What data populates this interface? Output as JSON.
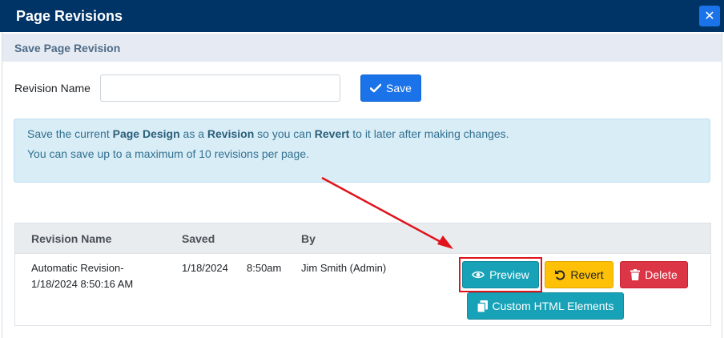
{
  "dialog": {
    "title": "Page Revisions",
    "close_icon": "close-icon"
  },
  "save_section": {
    "header": "Save Page Revision",
    "revision_name_label": "Revision Name",
    "revision_name_value": "",
    "save_label": "Save"
  },
  "info": {
    "line1": {
      "pre": "Save the current ",
      "bold1": "Page Design",
      "mid1": " as a ",
      "bold2": "Revision",
      "mid2": " so you can ",
      "bold3": "Revert",
      "post": " to it later after making changes."
    },
    "line2": "You can save up to a maximum of 10 revisions per page."
  },
  "table": {
    "headers": [
      "Revision Name",
      "Saved",
      "By"
    ],
    "rows": [
      {
        "name_line1": "Automatic Revision-",
        "name_line2": "1/18/2024 8:50:16 AM",
        "saved_date": "1/18/2024",
        "saved_time": "8:50am",
        "by": "Jim Smith (Admin)",
        "actions": {
          "preview": "Preview",
          "revert": "Revert",
          "delete": "Delete",
          "custom_html": "Custom HTML Elements"
        }
      }
    ]
  },
  "colors": {
    "titlebar": "#003366",
    "primary": "#1a73e8",
    "info": "#17a2b8",
    "warning": "#ffc107",
    "danger": "#dc3545",
    "annotation": "#e0131b"
  }
}
